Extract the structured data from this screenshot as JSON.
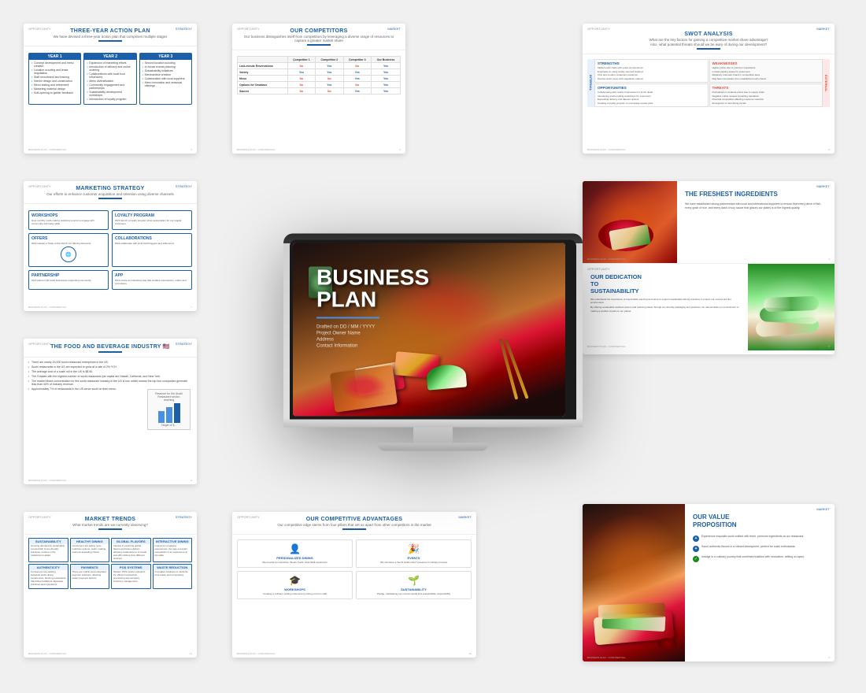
{
  "slides": {
    "three_year_plan": {
      "tag_left": "OPPORTUNITY",
      "tag_right": "STRATEGY",
      "title": "THREE-YEAR ACTION PLAN",
      "subtitle": "We have devised a three-year action plan that comprises multiple stages",
      "years": [
        {
          "label": "YEAR 1",
          "items": [
            "Concept development and menu creation",
            "Location scouting and lease negotiation",
            "Staff recruitment and training initiation",
            "Interior design and construction commencement",
            "Menu testing and refinement",
            "Marketing material design and branding",
            "Soft-opening to gather feedback"
          ]
        },
        {
          "label": "YEAR 2",
          "items": [
            "Expansion of marketing efforts",
            "Introduction of delivery and online ordering",
            "Collaborations with local food influencers",
            "Menu diversification based on customer feedback",
            "Community engagement and partnerships",
            "Sustainability development workshops",
            "Introduction of loyalty program"
          ]
        },
        {
          "label": "YEAR 3",
          "items": [
            "Second location scouting and preparation",
            "In-house events planning (sushi-making classes, themed nights)",
            "Sustainability initiatives",
            "Merchandise creation",
            "Collaboration with local suppliers and farms",
            "Menu innovation and seasonal offerings"
          ]
        }
      ],
      "footer_left": "BUSINESS PLAN - CONFIDENTIAL",
      "footer_right": "2"
    },
    "competitors": {
      "tag_left": "OPPORTUNITY",
      "tag_right": "MARKET",
      "title": "OUR COMPETITORS",
      "subtitle": "Our business distinguishes itself from competitors by leveraging a diverse range of resources to capture a greater market share",
      "columns": [
        "",
        "Last-minute Reservations",
        "Variety",
        "Menu",
        "Options for Omakase",
        "Sauces"
      ],
      "competitors": [
        "Competitor 1",
        "Competitor 2",
        "Competitor 3",
        "Our Business"
      ],
      "footer_left": "BUSINESS PLAN - CONFIDENTIAL",
      "footer_right": "4"
    },
    "swot": {
      "tag_left": "OPPORTUNITY",
      "tag_right": "MARKET",
      "title": "SWOT ANALYSIS",
      "subtitle_q1": "What are the key factors for gaining a competitive market share advantage?",
      "subtitle_q2": "Also, what potential threats should we be wary of during our development?",
      "strengths_title": "STRENGTHS",
      "weaknesses_title": "WEAKNESSES",
      "opportunities_title": "OPPORTUNITIES",
      "threats_title": "THREATS",
      "strengths_items": [
        "Skilled sushi chefs with years of experience",
        "Emphasis on using locally sourced seafood",
        "Chic and modern restaurant ambience",
        "Diverse sushi menu with vegetarian options"
      ],
      "weaknesses_items": [
        "Higher prices due to premium ingredients",
        "Limited parking space for customers",
        "Relatively unknown brand in competitive area",
        "May face competition from established sushi chains"
      ],
      "opportunities_items": [
        "Collaborating with nearby businesses for lunch deals",
        "Introducing sushi-making workshops for customers",
        "Expanding delivery and takeout options",
        "Creating a loyalty program to encourage repeat visits"
      ],
      "threats_items": [
        "Fluctuations in seafood prices due to supply chain issues",
        "Negative online reviews impacting reputation",
        "Potential competition affecting customer retention",
        "Emergence of new dining trends diverting customer attention"
      ],
      "internal_label": "INTERNAL",
      "external_label": "EXTERNAL",
      "footer_left": "BUSINESS PLAN - CONFIDENTIAL",
      "footer_right": "5"
    },
    "marketing": {
      "tag_left": "OPPORTUNITY",
      "tag_right": "STRATEGY",
      "title": "MARKETING STRATEGY",
      "subtitle": "Our efforts to enhance customer acquisition and retention using diverse channels",
      "boxes": [
        {
          "title": "WORKSHOPS",
          "text": "Host monthly sushi-making workshop events to engage with community and foster skills"
        },
        {
          "title": "LOYALTY PROGRAM",
          "text": "We'll launch a loyalty program show appreciation for our regular customers and to create a vibrant restaurant experience"
        },
        {
          "title": "OFFERS",
          "text": "We'll release a 'Taste of the Month' cut offering discounts, introduce new cuisines and menu"
        },
        {
          "title": "COLLABORATIONS",
          "text": "We'll collaborate with local food bloggers and influencers to create hype, trust and credibility"
        },
        {
          "title": "PARTNERSHIP",
          "text": "We'll partner with local businesses to create 'Taste of the Mat' set supporting community businesses"
        },
        {
          "title": "APP",
          "text": "We'll create an interactive App that enables reservations, orders and promotions"
        }
      ],
      "footer_left": "BUSINESS PLAN - CONFIDENTIAL",
      "footer_right": "7"
    },
    "freshest_ingredients": {
      "tag_left": "OPPORTUNITY",
      "tag_right": "MARKET",
      "title": "THE FRESHEST\nINGREDIENTS",
      "description": "We have established strong partnerships with local and international suppliers to ensure that every piece of fish, every grain of rice, and every dash of soy sauce that graces our plates is of the highest quality.",
      "footer_left": "BUSINESS PLAN - CONFIDENTIAL",
      "footer_right": "3"
    },
    "sustainability": {
      "tag_left": "OPPORTUNITY",
      "tag_right": "MARKET",
      "title": "OUR DEDICATION\nTO\nSUSTAINABILITY",
      "desc1": "We understand the importance of responsible sourcing and strive to support sustainable fishing practices to protect our oceans and the environment.",
      "desc2": "By offering sustainable seafood options and reducing waste through eco-friendly packaging and practices, we demonstrate our commitment to making a positive impact on our planet.",
      "footer_left": "BUSINESS PLAN - CONFIDENTIAL",
      "footer_right": "8"
    },
    "food_beverage": {
      "tag_left": "OPPORTUNITY",
      "tag_right": "STRATEGY",
      "title": "THE FOOD AND BEVERAGE INDUSTRY",
      "stats": [
        "There are nearly 20,000 sushi restaurant enterprises in the US.",
        "Sushi restaurants in the US are expected to grow at a rate of 2% YOY",
        "The average cost of a sushi roll in the US is $8.50.",
        "The 3 states with the highest number of sushi restaurants per capita are Hawaii, California, and New York.",
        "The market share concentration for the sushi restaurant industry in the US is low, which means the top four companies generate less than 40% of industry revenue.",
        "Approximately 7% of restaurants in the US serve sushi on their menu."
      ],
      "revenue_label": "Revenue for the Sushi Restaurant sector, reaching",
      "footer_left": "BUSINESS PLAN - CONFIDENTIAL",
      "footer_right": "9"
    },
    "market_trends": {
      "tag_left": "OPPORTUNITY",
      "tag_right": "STRATEGY",
      "title": "MARKET TRENDS",
      "subtitle": "What market trends are we currently observing?",
      "top_trends": [
        {
          "title": "SUSTAINABILITY",
          "text": "Growing demand for sustainably sourced fish & eco-friendly practices, pushes in the restaurant to adapt"
        },
        {
          "title": "HEALTHY DINING",
          "text": "Consumers are eating more nutritious options, sushi, making sushi an appealing choice"
        },
        {
          "title": "GLOBAL FLAVORS",
          "text": "Interest in exploring global flavors and fusion dishes, allowing restaurants to innovate and offer dishes from different cuisines"
        },
        {
          "title": "INTERACTIVE DINING",
          "text": "Interest for engaging experiences, the way out-sushi competition is an experience at the table"
        }
      ],
      "bottom_trends": [
        {
          "title": "AUTHENTICITY",
          "text": "Consumers are seeking authentic sushi dining experiences, favoring restaurants that follow traditional Japanese practices and ingredients"
        },
        {
          "title": "PAYMENTS",
          "text": "There are mobile web-integrated payment solutions, allowing easier payment options"
        },
        {
          "title": "POS SYSTEMS",
          "text": "Modern POS system solutions for efficient transaction processing and accuracy inventory management"
        },
        {
          "title": "WASTE REDUCTION",
          "text": "Innovative solutions to minimize food waste and composting"
        }
      ],
      "footer_left": "BUSINESS PLAN - CONFIDENTIAL",
      "footer_right": "11"
    },
    "competitive_advantages": {
      "tag_left": "OPPORTUNITY",
      "tag_right": "MARKET",
      "title": "OUR COMPETITIVE ADVANTAGES",
      "subtitle": "Our competitive edge stems from four pillars that set us apart from other competitors in the market",
      "pillars": [
        {
          "title": "PERSONALIZED DINING",
          "icon": "👤",
          "text": "We provide an interactive 'Studio Sushi' Chef-Staff experience for personalized dining"
        },
        {
          "title": "EVENTS",
          "icon": "🎉",
          "text": "We introduce a 'Sushi Studio Chef' presence in the culinary process"
        },
        {
          "title": "WORKSHOPS",
          "icon": "🎓",
          "text": "Creating a 'culinary' setting customers by hiring out from staff with sushi-crafting"
        },
        {
          "title": "SUSTAINABILITY",
          "icon": "🌱",
          "text": "Pledge, maintaining our environmental and sustainability responsibility"
        }
      ],
      "footer_left": "BUSINESS PLAN - CONFIDENTIAL",
      "footer_right": "12"
    },
    "value_proposition": {
      "tag_left": "OPPORTUNITY",
      "tag_right": "MARKET",
      "title": "OUR VALUE\nPROPOSITION",
      "items": [
        {
          "icon": "✦",
          "text": "Experience exquisite sushi crafted with fresh, premium ingredients at our restaurant."
        },
        {
          "icon": "✦",
          "text": "Savor authentic flavors in a vibrant atmosphere, perfect for sushi enthusiasts."
        },
        {
          "icon": "✓",
          "text": "Indulge in a culinary journey that combines tradition with innovation, setting us apart."
        }
      ],
      "footer_left": "BUSINESS PLAN - CONFIDENTIAL",
      "footer_right": "6"
    },
    "business_plan_cover": {
      "title": "BUSINESS",
      "title_line2": "PLAN",
      "drafted": "Drafted on DD / MM / YYYY",
      "project": "Project Owner Name",
      "address": "Address",
      "contact": "Contact Information"
    }
  },
  "monitor": {
    "screen_title_line1": "BUSINESS",
    "screen_title_line2": "PLAN",
    "screen_divider": true,
    "screen_drafted": "Drafted on DD / MM / YYYY",
    "screen_project": "Project Owner Name",
    "screen_address": "Address",
    "screen_contact": "Contact Information"
  }
}
